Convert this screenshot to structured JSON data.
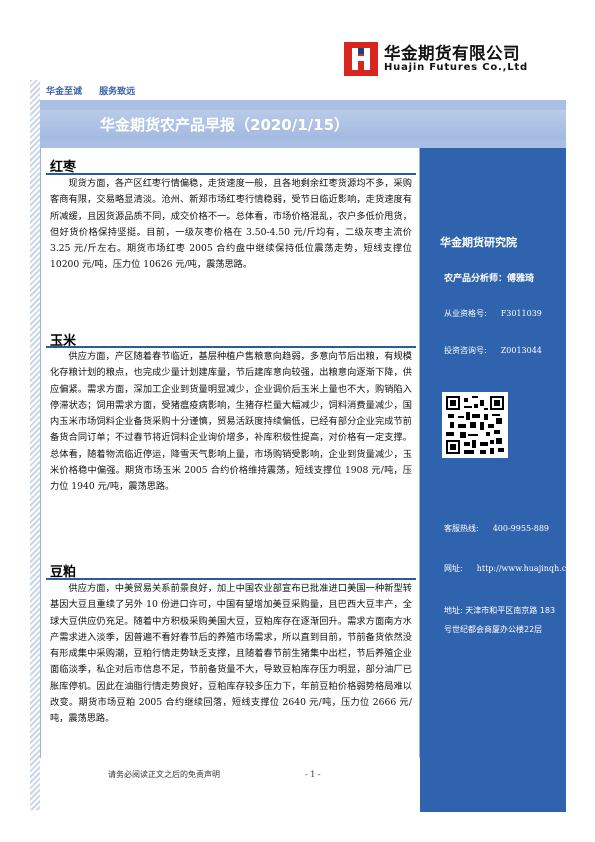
{
  "header": {
    "company_cn": "华金期货有限公司",
    "company_en": "Huajin Futures Co.,Ltd",
    "slogans": [
      "华金至诚",
      "服务致远"
    ]
  },
  "banner": {
    "title": "华金期货农产品早报（2020/1/15）"
  },
  "sections": [
    {
      "title": "红枣",
      "text": "现货方面，各产区红枣行情偏稳，走货速度一般，且各地剩余红枣货源均不多，采购客商有限，交易略显清淡。沧州、新郑市场红枣行情稳弱，受节日临近影响，走货速度有所减缓，且因货源品质不同，成交价格不一。总体看，市场价格混乱，农户多低价甩货，但好货价格保持坚挺。目前，一级灰枣价格在 3.50-4.50 元/斤均有，二级灰枣主流价 3.25 元/斤左右。期货市场红枣 2005 合约盘中继续保持低位震荡走势，短线支撑位 10200 元/吨，压力位 10626 元/吨，震荡思路。"
    },
    {
      "title": "玉米",
      "text": "供应方面，产区随着春节临近，基层种植户售粮意向趋弱，多意向节后出粮，有规模化存粮计划的粮点，也完成少量计划建库量，节后建库意向较强，出粮意向逐渐下降，供应偏紧。需求方面，深加工企业到货量明显减少，企业调价后玉米上量也不大，购销陷入停滞状态；饲用需求方面，受猪瘟疫病影响，生猪存栏量大幅减少，饲料消费量减少，国内玉米市场饲料企业备货采购十分谨慎，贸易活跃度持续偏低，已经有部分企业完成节前备货合同订单；不过春节将近饲料企业询价增多，补库积极性提高，对价格有一定支撑。总体看，随着物流临近停运，降雪天气影响上量，市场购销受影响，企业到货量减少，玉米价格稳中偏强。期货市场玉米 2005 合约价格维持震荡，短线支撑位 1908 元/吨，压力位 1940 元/吨，震荡思路。"
    },
    {
      "title": "豆粕",
      "text": "供应方面，中美贸易关系前景良好，加上中国农业部宣布已批准进口美国一种新型转基因大豆且重续了另外 10 份进口许可，中国有望增加美豆采购量，且巴西大豆丰产，全球大豆供应仍充足。随着中方积极采购美国大豆，豆粕库存在逐渐回升。需求方面南方水产需求进入淡季，因普遍不看好春节后的养殖市场需求，所以直到目前，节前备货依然没有形成集中采购潮，豆粕行情走势缺乏支撑，且随着春节前生猪集中出栏，节后养殖企业面临淡季，私企对后市信息不足，节前备货量不大，导致豆粕库存压力明显，部分油厂已胀库停机。因此在油脂行情走势良好，豆粕库存较多压力下，年前豆粕价格弱势格局难以改变。期货市场豆粕 2005 合约继续回落，短线支撑位 2640 元/吨，压力位 2666 元/吨，震荡思路。"
    }
  ],
  "sidebar": {
    "institute": "华金期货研究院",
    "analyst": "农产品分析师：傅雅琦",
    "qualification_label": "从业资格号:",
    "qualification_value": "F3011039",
    "consult_label": "投资咨询号:",
    "consult_value": "Z0013044",
    "hotline_label": "客服热线:",
    "hotline_value": "400-9955-889",
    "website_label": "网址:",
    "website_value": "http://www.huajinqh.com/",
    "address": "地址: 天津市和平区南京路 183 号世纪都会商厦办公楼22层"
  },
  "footer": {
    "page": "- 1 -",
    "note": "请务必阅读正文之后的免责声明"
  },
  "colors": {
    "brand_blue": "#2f63ad",
    "logo_red": "#d7261e",
    "banner": "#a9bfe3"
  }
}
